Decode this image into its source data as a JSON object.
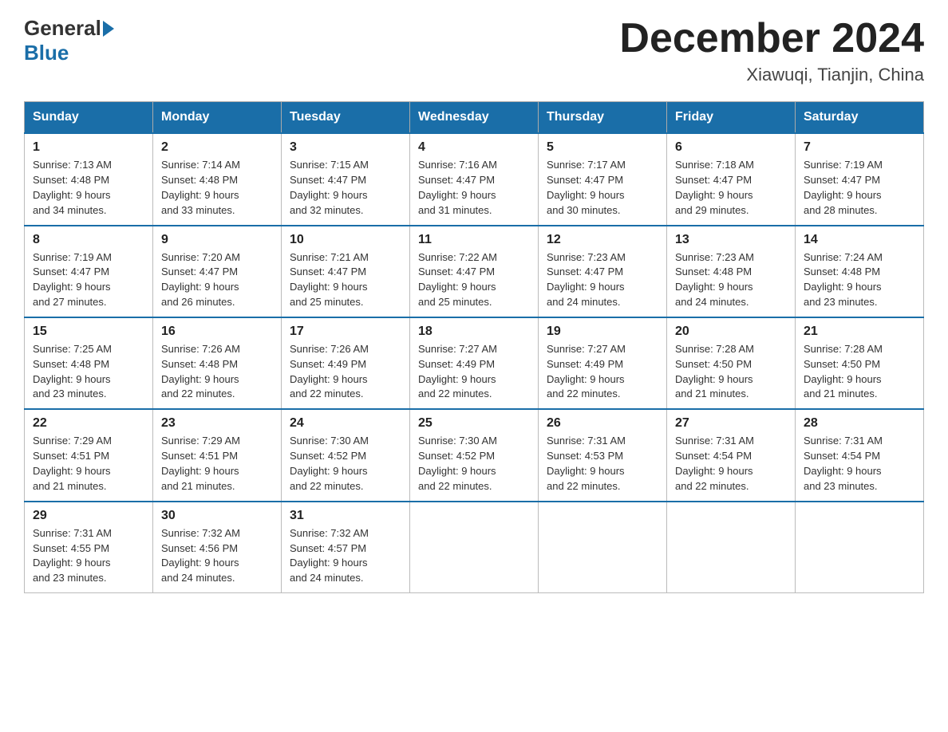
{
  "logo": {
    "text_before": "General",
    "text_after": "Blue"
  },
  "title": "December 2024",
  "location": "Xiawuqi, Tianjin, China",
  "days_of_week": [
    "Sunday",
    "Monday",
    "Tuesday",
    "Wednesday",
    "Thursday",
    "Friday",
    "Saturday"
  ],
  "weeks": [
    [
      {
        "day": 1,
        "sunrise": "7:13 AM",
        "sunset": "4:48 PM",
        "daylight": "9 hours and 34 minutes."
      },
      {
        "day": 2,
        "sunrise": "7:14 AM",
        "sunset": "4:48 PM",
        "daylight": "9 hours and 33 minutes."
      },
      {
        "day": 3,
        "sunrise": "7:15 AM",
        "sunset": "4:47 PM",
        "daylight": "9 hours and 32 minutes."
      },
      {
        "day": 4,
        "sunrise": "7:16 AM",
        "sunset": "4:47 PM",
        "daylight": "9 hours and 31 minutes."
      },
      {
        "day": 5,
        "sunrise": "7:17 AM",
        "sunset": "4:47 PM",
        "daylight": "9 hours and 30 minutes."
      },
      {
        "day": 6,
        "sunrise": "7:18 AM",
        "sunset": "4:47 PM",
        "daylight": "9 hours and 29 minutes."
      },
      {
        "day": 7,
        "sunrise": "7:19 AM",
        "sunset": "4:47 PM",
        "daylight": "9 hours and 28 minutes."
      }
    ],
    [
      {
        "day": 8,
        "sunrise": "7:19 AM",
        "sunset": "4:47 PM",
        "daylight": "9 hours and 27 minutes."
      },
      {
        "day": 9,
        "sunrise": "7:20 AM",
        "sunset": "4:47 PM",
        "daylight": "9 hours and 26 minutes."
      },
      {
        "day": 10,
        "sunrise": "7:21 AM",
        "sunset": "4:47 PM",
        "daylight": "9 hours and 25 minutes."
      },
      {
        "day": 11,
        "sunrise": "7:22 AM",
        "sunset": "4:47 PM",
        "daylight": "9 hours and 25 minutes."
      },
      {
        "day": 12,
        "sunrise": "7:23 AM",
        "sunset": "4:47 PM",
        "daylight": "9 hours and 24 minutes."
      },
      {
        "day": 13,
        "sunrise": "7:23 AM",
        "sunset": "4:48 PM",
        "daylight": "9 hours and 24 minutes."
      },
      {
        "day": 14,
        "sunrise": "7:24 AM",
        "sunset": "4:48 PM",
        "daylight": "9 hours and 23 minutes."
      }
    ],
    [
      {
        "day": 15,
        "sunrise": "7:25 AM",
        "sunset": "4:48 PM",
        "daylight": "9 hours and 23 minutes."
      },
      {
        "day": 16,
        "sunrise": "7:26 AM",
        "sunset": "4:48 PM",
        "daylight": "9 hours and 22 minutes."
      },
      {
        "day": 17,
        "sunrise": "7:26 AM",
        "sunset": "4:49 PM",
        "daylight": "9 hours and 22 minutes."
      },
      {
        "day": 18,
        "sunrise": "7:27 AM",
        "sunset": "4:49 PM",
        "daylight": "9 hours and 22 minutes."
      },
      {
        "day": 19,
        "sunrise": "7:27 AM",
        "sunset": "4:49 PM",
        "daylight": "9 hours and 22 minutes."
      },
      {
        "day": 20,
        "sunrise": "7:28 AM",
        "sunset": "4:50 PM",
        "daylight": "9 hours and 21 minutes."
      },
      {
        "day": 21,
        "sunrise": "7:28 AM",
        "sunset": "4:50 PM",
        "daylight": "9 hours and 21 minutes."
      }
    ],
    [
      {
        "day": 22,
        "sunrise": "7:29 AM",
        "sunset": "4:51 PM",
        "daylight": "9 hours and 21 minutes."
      },
      {
        "day": 23,
        "sunrise": "7:29 AM",
        "sunset": "4:51 PM",
        "daylight": "9 hours and 21 minutes."
      },
      {
        "day": 24,
        "sunrise": "7:30 AM",
        "sunset": "4:52 PM",
        "daylight": "9 hours and 22 minutes."
      },
      {
        "day": 25,
        "sunrise": "7:30 AM",
        "sunset": "4:52 PM",
        "daylight": "9 hours and 22 minutes."
      },
      {
        "day": 26,
        "sunrise": "7:31 AM",
        "sunset": "4:53 PM",
        "daylight": "9 hours and 22 minutes."
      },
      {
        "day": 27,
        "sunrise": "7:31 AM",
        "sunset": "4:54 PM",
        "daylight": "9 hours and 22 minutes."
      },
      {
        "day": 28,
        "sunrise": "7:31 AM",
        "sunset": "4:54 PM",
        "daylight": "9 hours and 23 minutes."
      }
    ],
    [
      {
        "day": 29,
        "sunrise": "7:31 AM",
        "sunset": "4:55 PM",
        "daylight": "9 hours and 23 minutes."
      },
      {
        "day": 30,
        "sunrise": "7:32 AM",
        "sunset": "4:56 PM",
        "daylight": "9 hours and 24 minutes."
      },
      {
        "day": 31,
        "sunrise": "7:32 AM",
        "sunset": "4:57 PM",
        "daylight": "9 hours and 24 minutes."
      },
      null,
      null,
      null,
      null
    ]
  ],
  "labels": {
    "sunrise": "Sunrise:",
    "sunset": "Sunset:",
    "daylight": "Daylight:"
  }
}
